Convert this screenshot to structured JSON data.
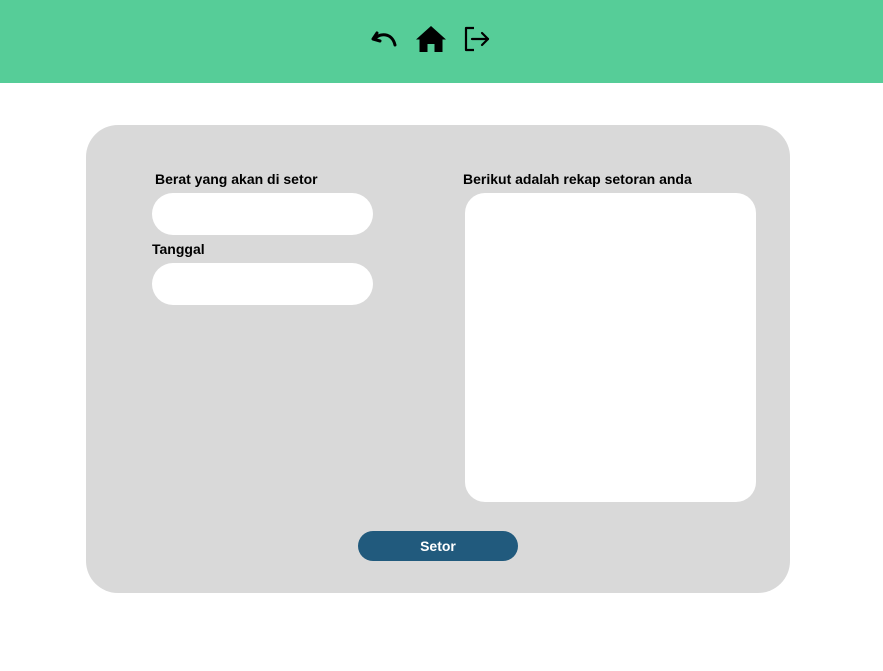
{
  "header": {
    "background_color": "#56cd98",
    "icons": [
      {
        "name": "undo-icon"
      },
      {
        "name": "home-icon"
      },
      {
        "name": "logout-icon"
      }
    ]
  },
  "form": {
    "weight_label": "Berat yang akan di setor",
    "weight_value": "",
    "date_label": "Tanggal",
    "date_value": "",
    "recap_label": "Berikut adalah rekap setoran anda",
    "recap_content": "",
    "submit_label": "Setor",
    "card_color": "#d9d9d9",
    "button_color": "#215a7d"
  }
}
